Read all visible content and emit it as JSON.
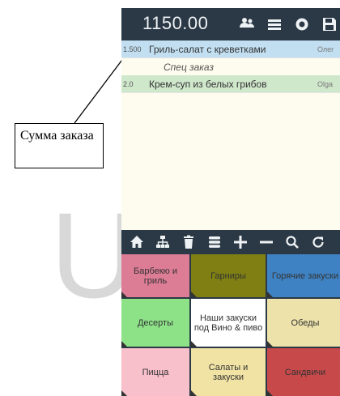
{
  "annotation": {
    "label": "Сумма заказа"
  },
  "header": {
    "total": "1150.00",
    "icons": [
      "users-icon",
      "menu-icon",
      "settings-icon",
      "save-icon"
    ]
  },
  "order": {
    "rows": [
      {
        "qty": "1.500",
        "name": "Гриль-салат с креветками",
        "waiter": "Олег"
      },
      {
        "qty": "",
        "name": "Спец заказ",
        "waiter": ""
      },
      {
        "qty": "2.0",
        "name": "Крем-суп из белых грибов",
        "waiter": "Olga"
      }
    ]
  },
  "toolbar": {
    "icons": [
      "home-icon",
      "sitemap-icon",
      "trash-icon",
      "list-icon",
      "plus-icon",
      "minus-icon",
      "search-icon",
      "refresh-icon"
    ]
  },
  "categories": [
    {
      "label": "Барбекю и гриль",
      "color": "#dc7c95"
    },
    {
      "label": "Гарниры",
      "color": "#7f7f13"
    },
    {
      "label": "Горячие закуски",
      "color": "#3f82c3"
    },
    {
      "label": "Десерты",
      "color": "#8de288"
    },
    {
      "label": "Наши закуски под Вино & пиво",
      "color": "#ffffff"
    },
    {
      "label": "Обеды",
      "color": "#ede2aa"
    },
    {
      "label": "Пицца",
      "color": "#f8c0cb"
    },
    {
      "label": "Салаты и закуски",
      "color": "#f1e3a4"
    },
    {
      "label": "Сандвичи",
      "color": "#c8494a"
    }
  ]
}
